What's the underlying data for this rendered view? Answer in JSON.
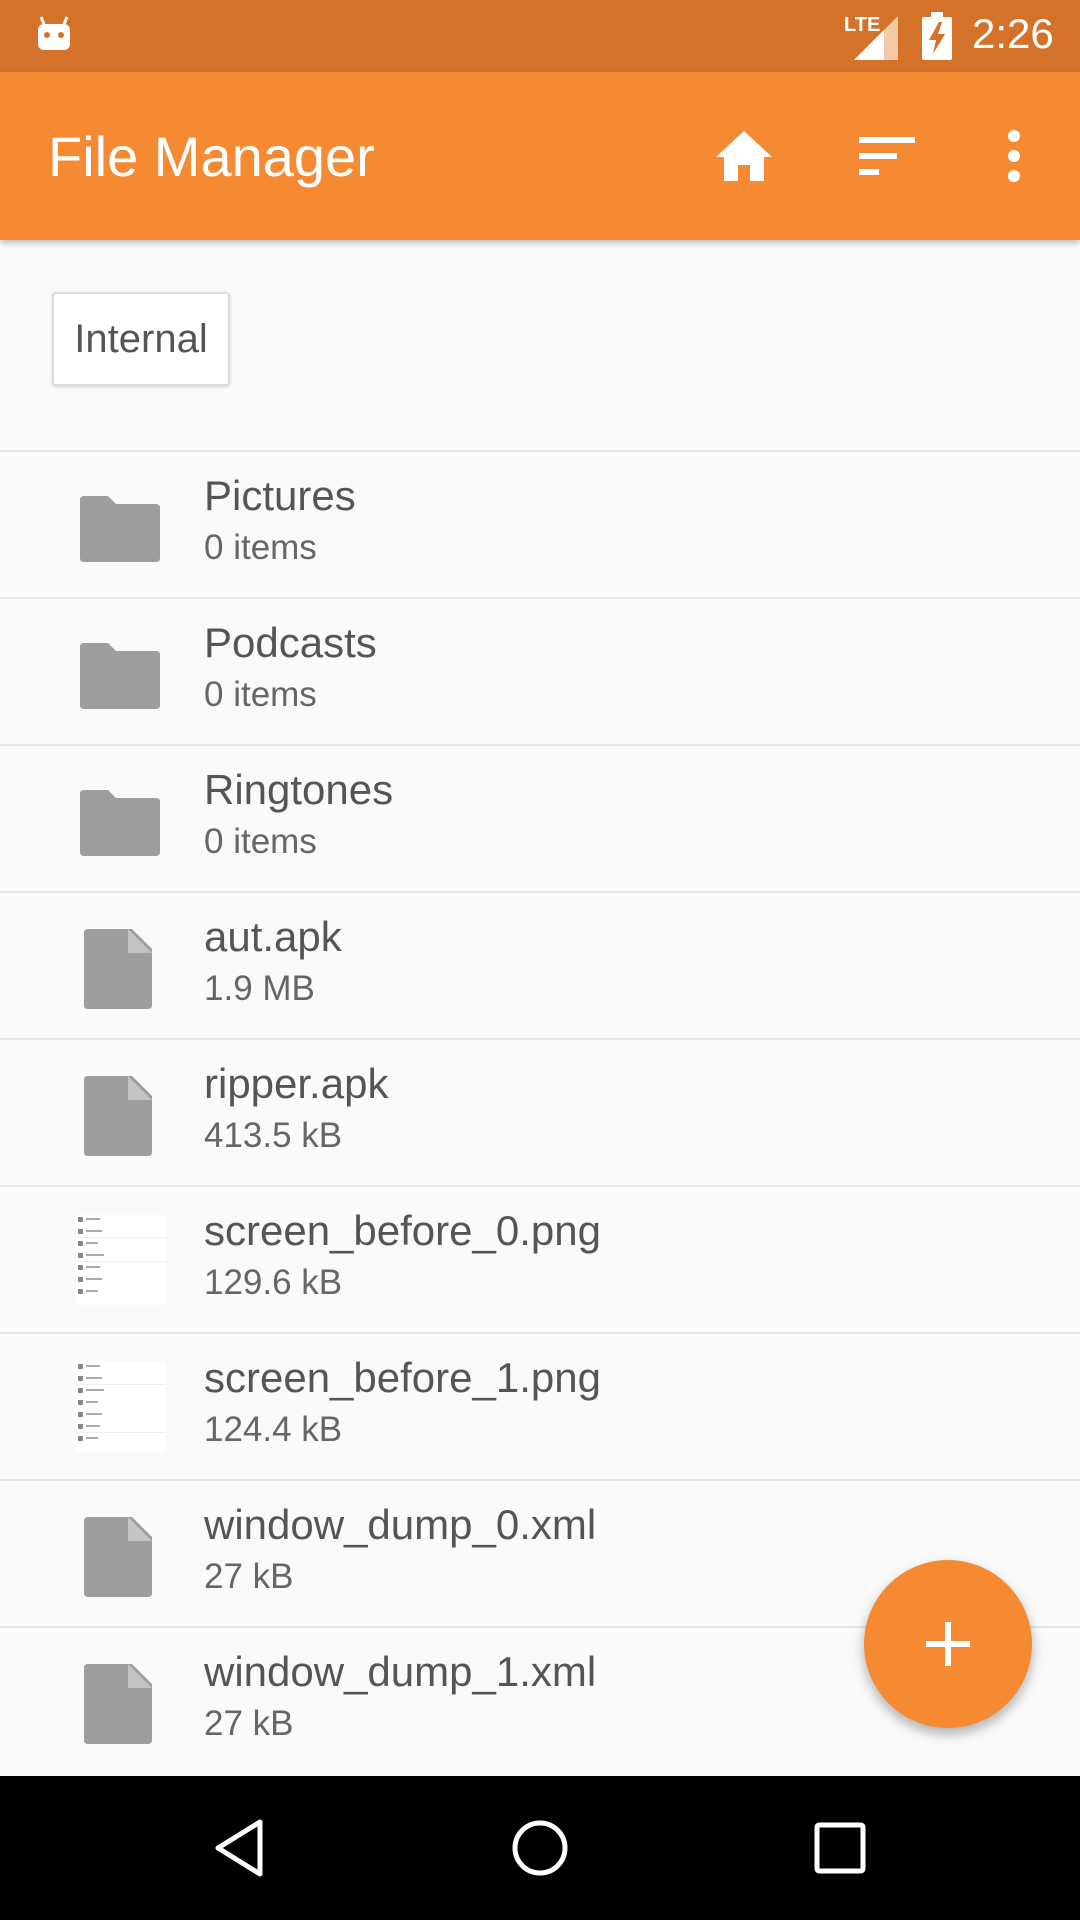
{
  "status_bar": {
    "network": "LTE",
    "time": "2:26",
    "icons": [
      "android-icon",
      "signal-icon",
      "battery-charging-icon"
    ]
  },
  "app_bar": {
    "title": "File Manager",
    "actions": [
      "home-icon",
      "sort-icon",
      "more-vert-icon"
    ]
  },
  "path": {
    "current": "Internal"
  },
  "files": [
    {
      "name": "Pictures",
      "meta": "0 items",
      "type": "folder"
    },
    {
      "name": "Podcasts",
      "meta": "0 items",
      "type": "folder"
    },
    {
      "name": "Ringtones",
      "meta": "0 items",
      "type": "folder"
    },
    {
      "name": "aut.apk",
      "meta": "1.9 MB",
      "type": "file"
    },
    {
      "name": "ripper.apk",
      "meta": "413.5 kB",
      "type": "file"
    },
    {
      "name": "screen_before_0.png",
      "meta": "129.6 kB",
      "type": "image"
    },
    {
      "name": "screen_before_1.png",
      "meta": "124.4 kB",
      "type": "image"
    },
    {
      "name": "window_dump_0.xml",
      "meta": "27 kB",
      "type": "file"
    },
    {
      "name": "window_dump_1.xml",
      "meta": "27 kB",
      "type": "file"
    }
  ],
  "fab": {
    "icon": "plus-icon"
  },
  "nav_bar": {
    "buttons": [
      "back-icon",
      "home-circle-icon",
      "recents-icon"
    ]
  },
  "colors": {
    "status_bar": "#d4722a",
    "app_bar": "#f68a32",
    "accent": "#f68a32",
    "icon_gray": "#9e9e9e",
    "background": "#fafafa"
  }
}
